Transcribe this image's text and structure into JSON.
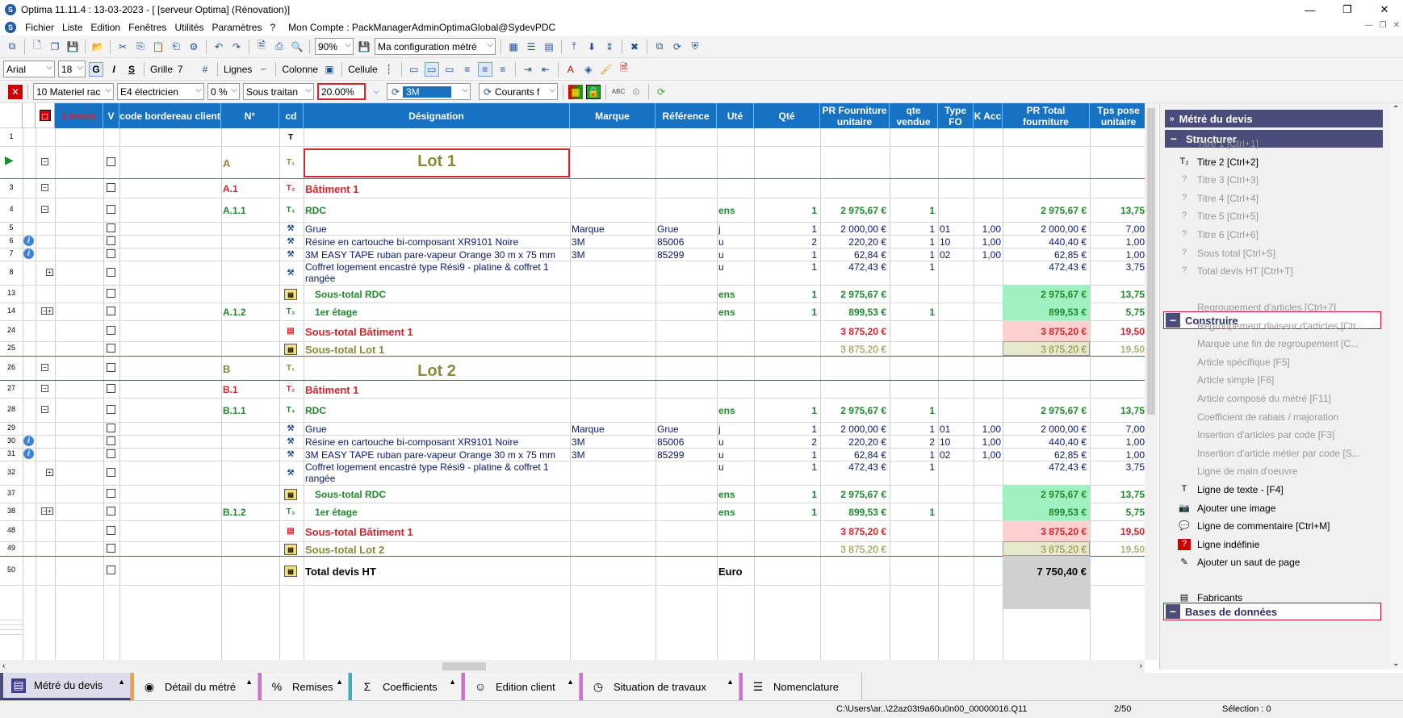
{
  "window": {
    "title": "Optima 11.11.4 : 13-03-2023 - [ [serveur Optima] (Rénovation)]",
    "controls": [
      "—",
      "❐",
      "✕"
    ]
  },
  "menu": {
    "items": [
      "Fichier",
      "Liste",
      "Edition",
      "Fenêtres",
      "Utilités",
      "Paramètres",
      "?"
    ],
    "account": "Mon Compte : PackManagerAdminOptimaGlobal@SydevPDC",
    "mdi_controls": [
      "—",
      "❐",
      "✕"
    ]
  },
  "toolbar1": {
    "zoom": "90%",
    "config": "Ma configuration métré"
  },
  "toolbar2": {
    "font": "Arial",
    "size": "18",
    "bold": "G",
    "italic": "I",
    "strike": "S",
    "grille_label": "Grille",
    "grille_value": "7",
    "lignes_label": "Lignes",
    "colonne_label": "Colonne",
    "cellule_label": "Cellule"
  },
  "toolbar3": {
    "material": "10  Materiel rac",
    "trade": "E4  électricien",
    "pct_small": "0 %",
    "subcontract": "Sous traitan",
    "percent": "20.00%",
    "brand": "3M",
    "courants": "Courants f"
  },
  "grid": {
    "headers": {
      "linoxis": "Linoxis",
      "v": "V",
      "code": "code bordereau client",
      "num": "N°",
      "cd": "cd",
      "designation": "Désignation",
      "marque": "Marque",
      "reference": "Référence",
      "ute": "Uté",
      "qte": "Qté",
      "pr_fourniture": "PR Fourniture unitaire",
      "qte_vendue": "qte vendue",
      "type_fo": "Type FO",
      "k_acc": "K Acc",
      "pr_total": "PR Total fourniture",
      "tps_pose": "Tps pose unitaire"
    },
    "rows": [
      {
        "n": "1",
        "num": "",
        "des": "",
        "marque": "",
        "ref": "",
        "ute": "",
        "qte": "",
        "pr": "",
        "qv": "",
        "fo": "",
        "k": "",
        "total": "",
        "tps": ""
      },
      {
        "n": "",
        "num": "A",
        "des": "Lot 1",
        "marque": "",
        "ref": "",
        "ute": "",
        "qte": "",
        "pr": "",
        "qv": "",
        "fo": "",
        "k": "",
        "total": "",
        "tps": ""
      },
      {
        "n": "3",
        "num": "A.1",
        "des": "Bâtiment 1",
        "marque": "",
        "ref": "",
        "ute": "",
        "qte": "",
        "pr": "",
        "qv": "",
        "fo": "",
        "k": "",
        "total": "",
        "tps": ""
      },
      {
        "n": "4",
        "num": "A.1.1",
        "des": "RDC",
        "marque": "",
        "ref": "",
        "ute": "ens",
        "qte": "1",
        "pr": "2 975,67 €",
        "qv": "1",
        "fo": "",
        "k": "",
        "total": "2 975,67 €",
        "tps": "13,75"
      },
      {
        "n": "5",
        "num": "",
        "des": "Grue",
        "marque": "Marque",
        "ref": "Grue",
        "ute": "j",
        "qte": "1",
        "pr": "2 000,00 €",
        "qv": "1",
        "fo": "01",
        "k": "1,00",
        "total": "2 000,00 €",
        "tps": "7,00"
      },
      {
        "n": "6",
        "num": "",
        "des": "Résine en cartouche bi-composant XR9101 Noire",
        "marque": "3M",
        "ref": "85006",
        "ute": "u",
        "qte": "2",
        "pr": "220,20 €",
        "qv": "1",
        "fo": "10",
        "k": "1,00",
        "total": "440,40 €",
        "tps": "1,00"
      },
      {
        "n": "7",
        "num": "",
        "des": "3M EASY TAPE ruban pare-vapeur Orange 30 m x 75 mm",
        "marque": "3M",
        "ref": "85299",
        "ute": "u",
        "qte": "1",
        "pr": "62,84 €",
        "qv": "1",
        "fo": "02",
        "k": "1,00",
        "total": "62,85 €",
        "tps": "1,00"
      },
      {
        "n": "8",
        "num": "",
        "des": "Coffret logement encastré type Rési9 - platine & coffret 1",
        "des2": "rangée",
        "marque": "",
        "ref": "",
        "ute": "u",
        "qte": "1",
        "pr": "472,43 €",
        "qv": "1",
        "fo": "",
        "k": "",
        "total": "472,43 €",
        "tps": "3,75"
      },
      {
        "n": "13",
        "num": "",
        "des": "Sous-total RDC",
        "marque": "",
        "ref": "",
        "ute": "ens",
        "qte": "1",
        "pr": "2 975,67 €",
        "qv": "",
        "fo": "",
        "k": "",
        "total": "2 975,67 €",
        "tps": "13,75"
      },
      {
        "n": "14",
        "num": "A.1.2",
        "des": "1er étage",
        "marque": "",
        "ref": "",
        "ute": "ens",
        "qte": "1",
        "pr": "899,53 €",
        "qv": "1",
        "fo": "",
        "k": "",
        "total": "899,53 €",
        "tps": "5,75"
      },
      {
        "n": "24",
        "num": "",
        "des": "Sous-total Bâtiment 1",
        "marque": "",
        "ref": "",
        "ute": "",
        "qte": "",
        "pr": "3 875,20 €",
        "qv": "",
        "fo": "",
        "k": "",
        "total": "3 875,20 €",
        "tps": "19,50"
      },
      {
        "n": "25",
        "num": "",
        "des": "Sous-total Lot 1",
        "marque": "",
        "ref": "",
        "ute": "",
        "qte": "",
        "pr": "3 875,20 €",
        "qv": "",
        "fo": "",
        "k": "",
        "total": "3 875,20 €",
        "tps": "19,50"
      },
      {
        "n": "26",
        "num": "B",
        "des": "Lot 2",
        "marque": "",
        "ref": "",
        "ute": "",
        "qte": "",
        "pr": "",
        "qv": "",
        "fo": "",
        "k": "",
        "total": "",
        "tps": ""
      },
      {
        "n": "27",
        "num": "B.1",
        "des": "Bâtiment 1",
        "marque": "",
        "ref": "",
        "ute": "",
        "qte": "",
        "pr": "",
        "qv": "",
        "fo": "",
        "k": "",
        "total": "",
        "tps": ""
      },
      {
        "n": "28",
        "num": "B.1.1",
        "des": "RDC",
        "marque": "",
        "ref": "",
        "ute": "ens",
        "qte": "1",
        "pr": "2 975,67 €",
        "qv": "1",
        "fo": "",
        "k": "",
        "total": "2 975,67 €",
        "tps": "13,75"
      },
      {
        "n": "29",
        "num": "",
        "des": "Grue",
        "marque": "Marque",
        "ref": "Grue",
        "ute": "j",
        "qte": "1",
        "pr": "2 000,00 €",
        "qv": "1",
        "fo": "01",
        "k": "1,00",
        "total": "2 000,00 €",
        "tps": "7,00"
      },
      {
        "n": "30",
        "num": "",
        "des": "Résine en cartouche bi-composant XR9101 Noire",
        "marque": "3M",
        "ref": "85006",
        "ute": "u",
        "qte": "2",
        "pr": "220,20 €",
        "qv": "2",
        "fo": "10",
        "k": "1,00",
        "total": "440,40 €",
        "tps": "1,00"
      },
      {
        "n": "31",
        "num": "",
        "des": "3M EASY TAPE ruban pare-vapeur Orange 30 m x 75 mm",
        "marque": "3M",
        "ref": "85299",
        "ute": "u",
        "qte": "1",
        "pr": "62,84 €",
        "qv": "1",
        "fo": "02",
        "k": "1,00",
        "total": "62,85 €",
        "tps": "1,00"
      },
      {
        "n": "32",
        "num": "",
        "des": "Coffret logement encastré type Rési9 - platine & coffret 1",
        "des2": "rangée",
        "marque": "",
        "ref": "",
        "ute": "u",
        "qte": "1",
        "pr": "472,43 €",
        "qv": "1",
        "fo": "",
        "k": "",
        "total": "472,43 €",
        "tps": "3,75"
      },
      {
        "n": "37",
        "num": "",
        "des": "Sous-total RDC",
        "marque": "",
        "ref": "",
        "ute": "ens",
        "qte": "1",
        "pr": "2 975,67 €",
        "qv": "",
        "fo": "",
        "k": "",
        "total": "2 975,67 €",
        "tps": "13,75"
      },
      {
        "n": "38",
        "num": "B.1.2",
        "des": "1er étage",
        "marque": "",
        "ref": "",
        "ute": "ens",
        "qte": "1",
        "pr": "899,53 €",
        "qv": "1",
        "fo": "",
        "k": "",
        "total": "899,53 €",
        "tps": "5,75"
      },
      {
        "n": "48",
        "num": "",
        "des": "Sous-total Bâtiment 1",
        "marque": "",
        "ref": "",
        "ute": "",
        "qte": "",
        "pr": "3 875,20 €",
        "qv": "",
        "fo": "",
        "k": "",
        "total": "3 875,20 €",
        "tps": "19,50"
      },
      {
        "n": "49",
        "num": "",
        "des": "Sous-total Lot 2",
        "marque": "",
        "ref": "",
        "ute": "",
        "qte": "",
        "pr": "3 875,20 €",
        "qv": "",
        "fo": "",
        "k": "",
        "total": "3 875,20 €",
        "tps": "19,50"
      },
      {
        "n": "50",
        "num": "",
        "des": "Total devis HT",
        "marque": "",
        "ref": "",
        "ute": "Euro",
        "qte": "",
        "pr": "",
        "qv": "",
        "fo": "",
        "k": "",
        "total": "7 750,40 €",
        "tps": ""
      }
    ]
  },
  "panel": {
    "header": "Métré du devis",
    "sections": {
      "structurer": "Structurer",
      "construire": "Construire",
      "bases": "Bases de données"
    },
    "structurer_items": [
      "Titre 1 [Ctrl+1]",
      "Titre 2 [Ctrl+2]",
      "Titre 3 [Ctrl+3]",
      "Titre 4 [Ctrl+4]",
      "Titre 5 [Ctrl+5]",
      "Titre 6 [Ctrl+6]",
      "Sous total [Ctrl+S]",
      "Total devis HT [Ctrl+T]"
    ],
    "construire_items": [
      "Regroupement d'articles  [Ctrl+7]",
      "Regroupement diviseur d'articles [Ctr...",
      "Marque une fin de regroupement  [C...",
      "Article spécifique [F5]",
      "Article simple [F6]",
      "Article composé du métré [F11]",
      "Coefficient de rabais / majoration",
      "Insertion d'articles par code [F3]",
      "Insertion d'article métier par code [S...",
      "Ligne de main d'oeuvre",
      "Ligne de texte - [F4]",
      "Ajouter une image",
      "Ligne de commentaire [Ctrl+M]",
      "Ligne indéfinie",
      "Ajouter un saut de page"
    ],
    "bases_items": [
      "Fabricants"
    ]
  },
  "tabs": [
    "Métré du devis",
    "Détail du métré",
    "Remises",
    "Coefficients",
    "Edition client",
    "Situation de travaux",
    "Nomenclature"
  ],
  "status": {
    "path": "C:\\Users\\ar..\\22az03t9a60u0n00_00000016.Q11",
    "position": "2/50",
    "selection": "Sélection : 0"
  },
  "colors": {
    "header_blue": "#1872c4",
    "panel_dark": "#4a4d7a",
    "green_text": "#1f8a2c",
    "red_text": "#d3262e",
    "olive_text": "#8a8a3a",
    "green_highlight": "#a0f0c0",
    "pink_highlight": "#ffd0d0",
    "beige_highlight": "#e8e8cc",
    "gray_highlight": "#d0d0d0"
  }
}
